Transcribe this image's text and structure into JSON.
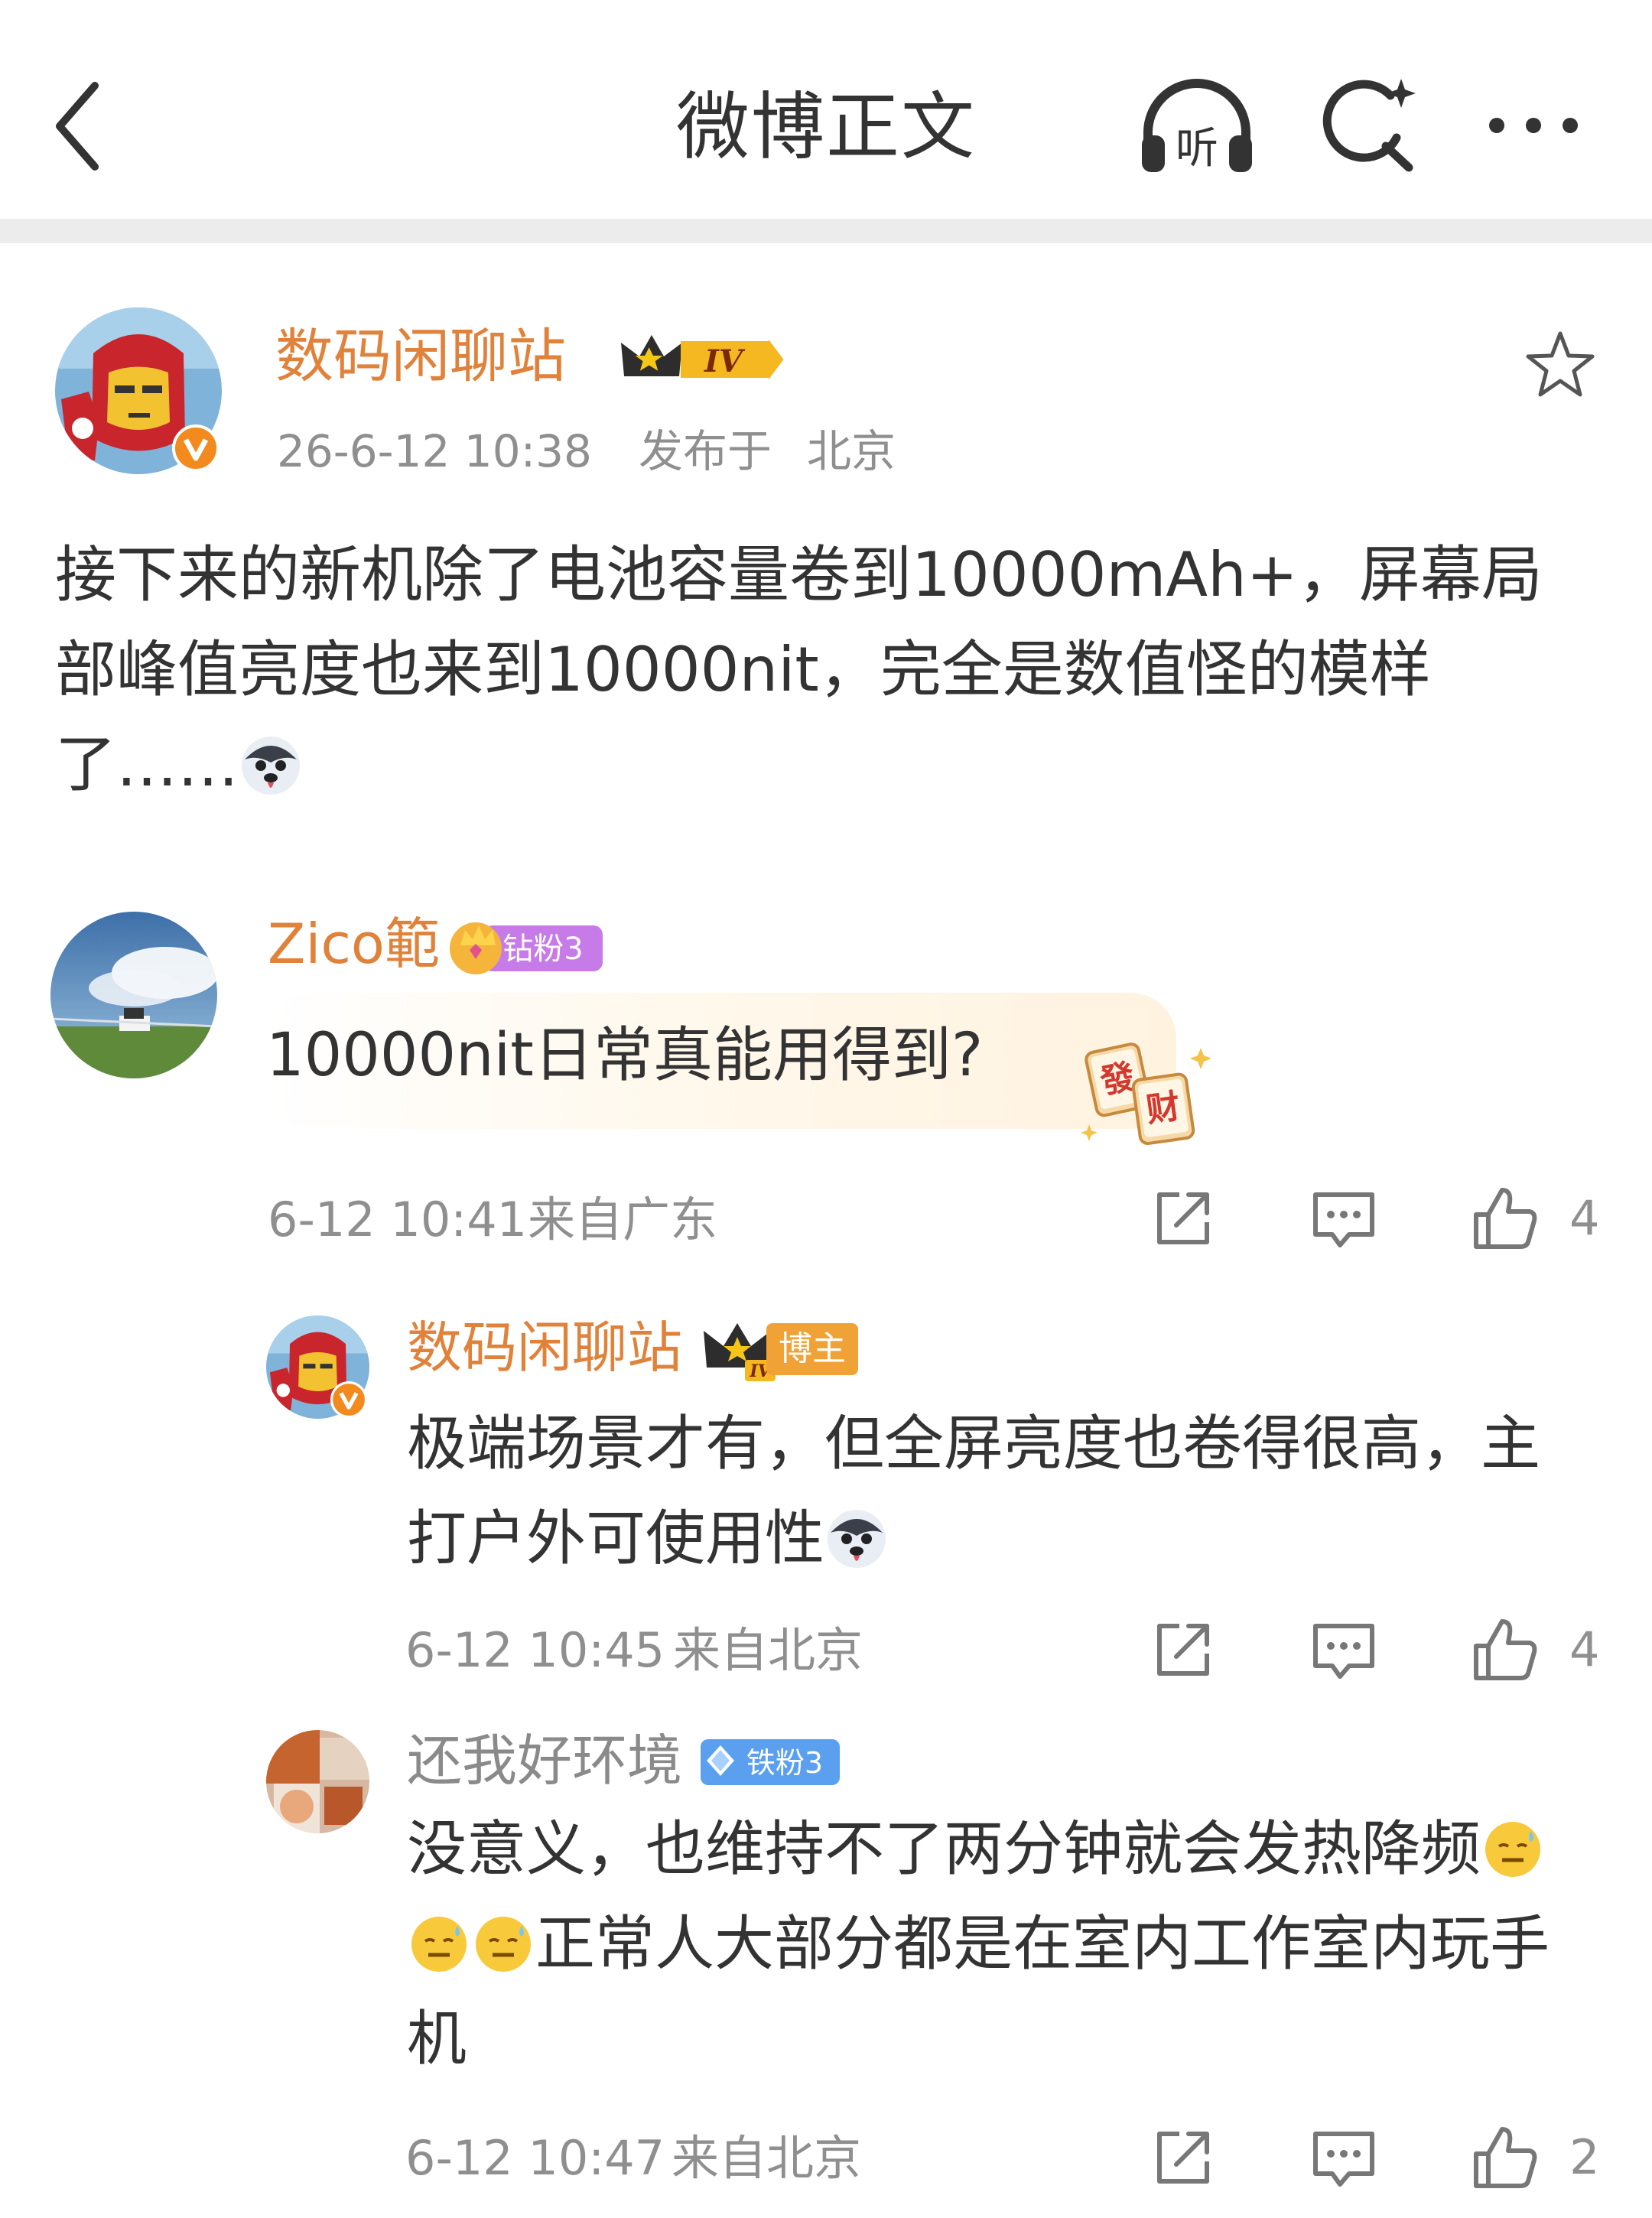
{
  "nav": {
    "title": "微博正文",
    "listen_label": "听"
  },
  "post": {
    "author": "数码闲聊站",
    "level_badge": "IV",
    "time": "26-6-12 10:38",
    "location_prefix": "发布于",
    "location": "北京",
    "text": "接下来的新机除了电池容量卷到10000mAh+，屏幕局部峰值亮度也来到10000nit，完全是数值怪的模样了……"
  },
  "comments": [
    {
      "name": "Zico範",
      "badge": "钻粉3",
      "text": "10000nit日常真能用得到?",
      "sticker_chars": [
        "發",
        "财"
      ],
      "time": "6-12 10:41",
      "location": "来自广东",
      "likes": "4",
      "replies": [
        {
          "name": "数码闲聊站",
          "badge": "博主",
          "level_badge": "IV",
          "text": "极端场景才有，但全屏亮度也卷得很高，主打户外可使用性",
          "time": "6-12 10:45",
          "location": "来自北京",
          "likes": "4"
        },
        {
          "name": "还我好环境",
          "badge": "铁粉3",
          "text_part1": "没意义，也维持不了两分钟就会发热降频",
          "text_part2": "正常人大部分都是在室内工作室内玩手机",
          "time": "6-12 10:47",
          "location": "来自北京",
          "likes": "2"
        }
      ]
    }
  ],
  "icons": {
    "back": "chevron-left-icon",
    "listen": "headphones-icon",
    "search": "ai-search-icon",
    "more": "ellipsis-icon",
    "favorite": "star-outline-icon",
    "share": "share-icon",
    "reply": "comment-icon",
    "like": "thumbs-up-icon"
  },
  "colors": {
    "author_orange": "#e1823b",
    "meta_gray": "#8f8f8f",
    "diamond_fan": "#c77be8",
    "iron_fan": "#5aa0ee",
    "blogger_tag": "#f0a236",
    "verified": "#f28a1e"
  }
}
